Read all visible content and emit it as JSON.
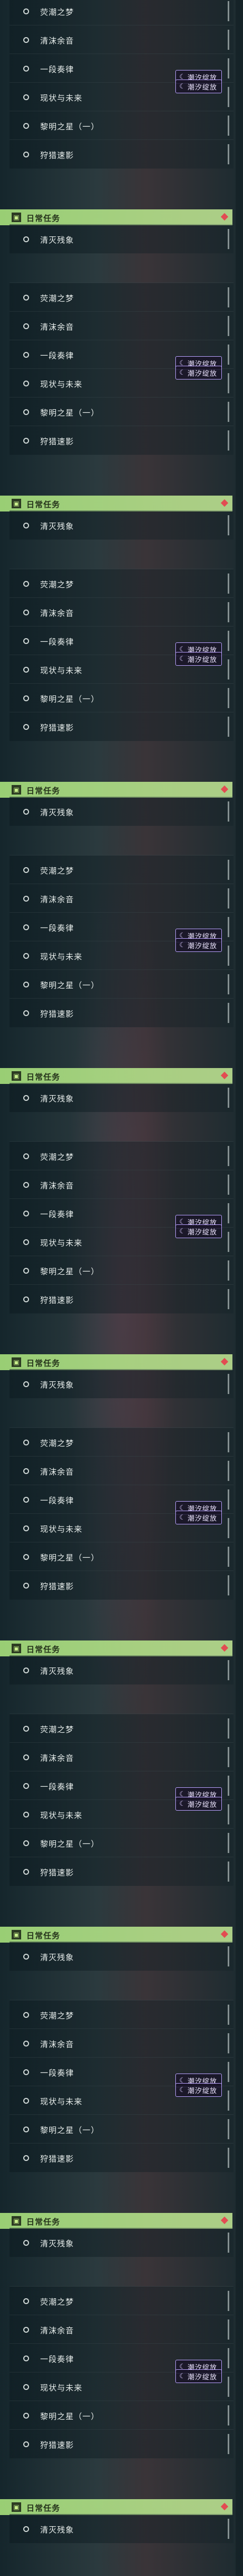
{
  "colors": {
    "accent_green": "#b8e67f",
    "tag_purple": "#b9a2ff",
    "alert_red": "#e24c52"
  },
  "tag": {
    "label": "潮汐绽放",
    "icon": "moon-icon"
  },
  "category": {
    "label": "日常任务",
    "icon": "calendar-icon"
  },
  "blocks": [
    {
      "tasks": [
        {
          "label": "荧潮之梦"
        },
        {
          "label": "清沫余音"
        },
        {
          "label": "一段奏律"
        },
        {
          "label": "现状与未来"
        },
        {
          "label": "黎明之星（一）"
        },
        {
          "label": "狩猎速影"
        }
      ],
      "daily_task": {
        "label": "清灭残象"
      }
    },
    {
      "tasks": [
        {
          "label": "荧潮之梦"
        },
        {
          "label": "清沫余音"
        },
        {
          "label": "一段奏律"
        },
        {
          "label": "现状与未来"
        },
        {
          "label": "黎明之星（一）"
        },
        {
          "label": "狩猎速影"
        }
      ],
      "daily_task": {
        "label": "清灭残象"
      }
    },
    {
      "tasks": [
        {
          "label": "荧潮之梦"
        },
        {
          "label": "清沫余音"
        },
        {
          "label": "一段奏律"
        },
        {
          "label": "现状与未来"
        },
        {
          "label": "黎明之星（一）"
        },
        {
          "label": "狩猎速影"
        }
      ],
      "daily_task": {
        "label": "清灭残象"
      }
    },
    {
      "tasks": [
        {
          "label": "荧潮之梦"
        },
        {
          "label": "清沫余音"
        },
        {
          "label": "一段奏律"
        },
        {
          "label": "现状与未来"
        },
        {
          "label": "黎明之星（一）"
        },
        {
          "label": "狩猎速影"
        }
      ],
      "daily_task": {
        "label": "清灭残象"
      }
    },
    {
      "tasks": [
        {
          "label": "荧潮之梦"
        },
        {
          "label": "清沫余音"
        },
        {
          "label": "一段奏律"
        },
        {
          "label": "现状与未来"
        },
        {
          "label": "黎明之星（一）"
        },
        {
          "label": "狩猎速影"
        }
      ],
      "daily_task": {
        "label": "清灭残象"
      }
    },
    {
      "tasks": [
        {
          "label": "荧潮之梦"
        },
        {
          "label": "清沫余音"
        },
        {
          "label": "一段奏律"
        },
        {
          "label": "现状与未来"
        },
        {
          "label": "黎明之星（一）"
        },
        {
          "label": "狩猎速影"
        }
      ],
      "daily_task": {
        "label": "清灭残象"
      }
    },
    {
      "tasks": [
        {
          "label": "荧潮之梦"
        },
        {
          "label": "清沫余音"
        },
        {
          "label": "一段奏律"
        },
        {
          "label": "现状与未来"
        },
        {
          "label": "黎明之星（一）"
        },
        {
          "label": "狩猎速影"
        }
      ],
      "daily_task": {
        "label": "清灭残象"
      }
    },
    {
      "tasks": [
        {
          "label": "荧潮之梦"
        },
        {
          "label": "清沫余音"
        },
        {
          "label": "一段奏律"
        },
        {
          "label": "现状与未来"
        },
        {
          "label": "黎明之星（一）"
        },
        {
          "label": "狩猎速影"
        }
      ],
      "daily_task": {
        "label": "清灭残象"
      }
    },
    {
      "tasks": [
        {
          "label": "荧潮之梦"
        },
        {
          "label": "清沫余音"
        },
        {
          "label": "一段奏律"
        },
        {
          "label": "现状与未来"
        },
        {
          "label": "黎明之星（一）"
        },
        {
          "label": "狩猎速影"
        }
      ],
      "daily_task": {
        "label": "清灭残象"
      }
    }
  ]
}
